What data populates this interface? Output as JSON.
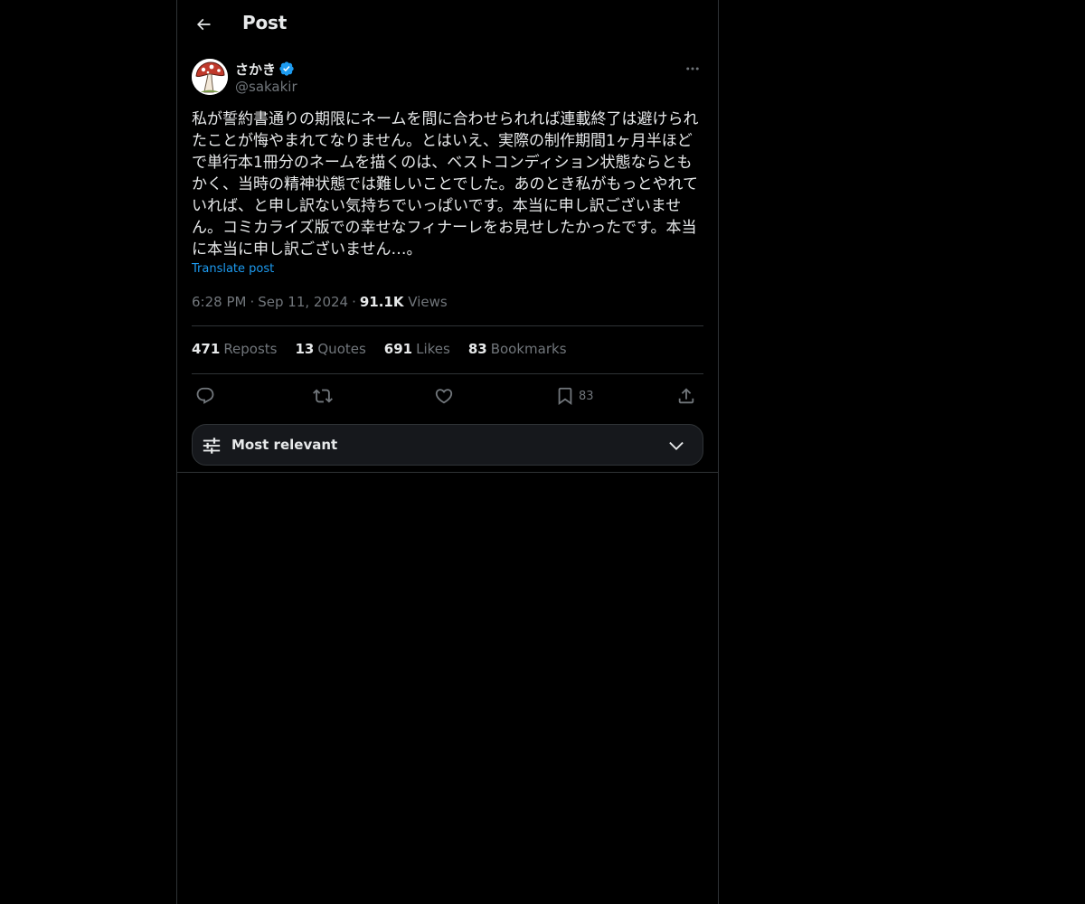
{
  "header": {
    "title": "Post",
    "back_icon": "arrow-left-icon"
  },
  "author": {
    "display_name": "さかき",
    "handle": "@sakakir",
    "verified": true,
    "avatar_icon": "mushroom-avatar-icon",
    "verified_color": "#1d9bf0"
  },
  "post": {
    "text": "私が誓約書通りの期限にネームを間に合わせられれば連載終了は避けられ\nたことが悔やまれてなりません。とはいえ、実際の制作期間1ヶ月半ほど\nで単行本1冊分のネームを描くのは、ベストコンディション状態ならとも\nかく、当時の精神状態では難しいことでした。あのとき私がもっとやれて\nいれば、と申し訳ない気持ちでいっぱいです。本当に申し訳ございませ\nん。コミカライズ版での幸せなフィナーレをお見せしたかったです。本当\nに本当に申し訳ございません…。",
    "translate_label": "Translate post"
  },
  "meta": {
    "time": "6:28 PM",
    "date": "Sep 11, 2024",
    "views_count": "91.1K",
    "views_label": "Views",
    "separator": "·"
  },
  "stats": [
    {
      "count": "471",
      "label": "Reposts"
    },
    {
      "count": "13",
      "label": "Quotes"
    },
    {
      "count": "691",
      "label": "Likes"
    },
    {
      "count": "83",
      "label": "Bookmarks"
    }
  ],
  "actions": {
    "reply_icon": "reply-icon",
    "repost_icon": "repost-icon",
    "like_icon": "heart-icon",
    "bookmark_icon": "bookmark-icon",
    "bookmark_count": "83",
    "share_icon": "share-icon"
  },
  "sort": {
    "label": "Most relevant",
    "icon": "sliders-icon",
    "chevron": "chevron-down-icon"
  },
  "colors": {
    "background": "#000000",
    "text": "#e7e9ea",
    "muted": "#71767b",
    "accent": "#1d9bf0",
    "border": "#2f3336"
  }
}
